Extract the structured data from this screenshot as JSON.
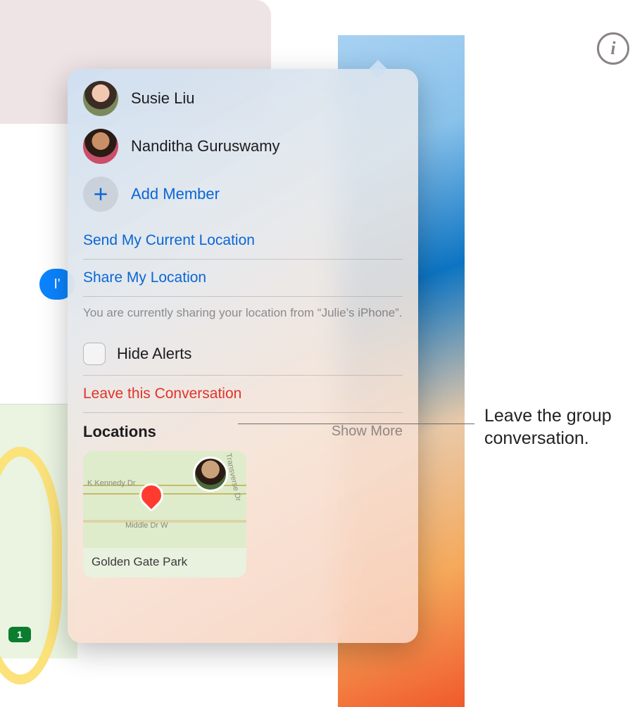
{
  "header": {
    "info_tooltip": "i"
  },
  "chat": {
    "bubble_snippet": "I'"
  },
  "bgmap": {
    "highway_badge": "1"
  },
  "popup": {
    "members": [
      {
        "name": "Susie Liu"
      },
      {
        "name": "Nanditha Guruswamy"
      }
    ],
    "add_member_label": "Add Member",
    "send_location_label": "Send My Current Location",
    "share_location_label": "Share My Location",
    "share_note": "You are currently sharing your location from “Julie’s iPhone”.",
    "hide_alerts_label": "Hide Alerts",
    "hide_alerts_checked": false,
    "leave_label": "Leave this Conversation",
    "locations_header": "Locations",
    "show_more_label": "Show More",
    "map_card": {
      "road1": "K Kennedy Dr",
      "road2": "Middle Dr W",
      "road3": "Transverse Dr",
      "caption": "Golden Gate Park"
    }
  },
  "annotation": {
    "text": "Leave the group conversation."
  },
  "colors": {
    "link": "#0a66d6",
    "destructive": "#e0332a"
  }
}
